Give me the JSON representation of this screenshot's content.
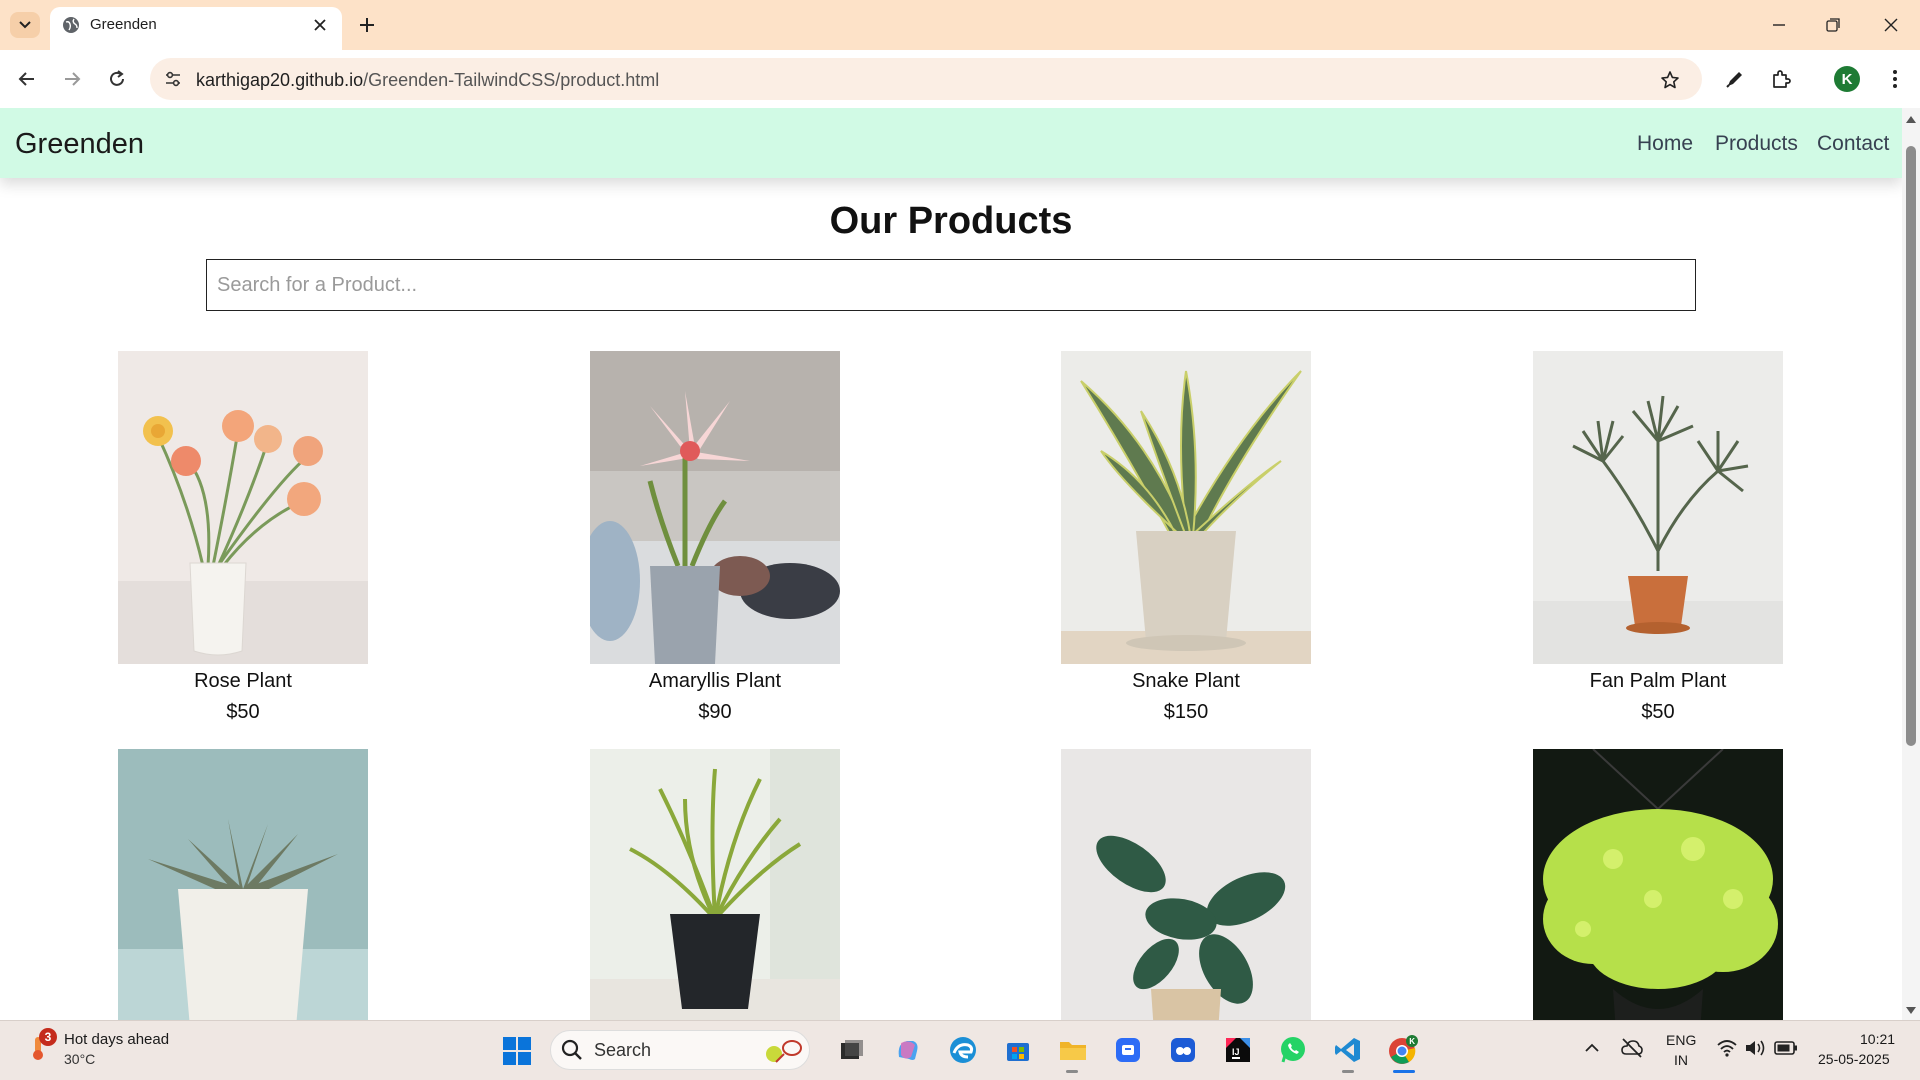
{
  "browser": {
    "tab_title": "Greenden",
    "url_host": "karthigap20.github.io",
    "url_path": "/Greenden-TailwindCSS/product.html",
    "profile_initial": "K"
  },
  "site": {
    "brand": "Greenden",
    "nav": [
      "Home",
      "Products",
      "Contact"
    ],
    "page_title": "Our Products",
    "search_placeholder": "Search for a Product...",
    "header_bg": "#d1fae5"
  },
  "products": [
    {
      "name": "Rose Plant",
      "price": "$50",
      "image": "ranunculus-bouquet-in-white-pot"
    },
    {
      "name": "Amaryllis Plant",
      "price": "$90",
      "image": "pink-amaryllis-in-grey-pot"
    },
    {
      "name": "Snake Plant",
      "price": "$150",
      "image": "snake-plant-in-beige-pot"
    },
    {
      "name": "Fan Palm Plant",
      "price": "$50",
      "image": "fan-palm-in-terracotta-pot"
    },
    {
      "name": "",
      "price": "",
      "image": "haworthia-succulent-in-white-pot"
    },
    {
      "name": "",
      "price": "",
      "image": "grass-plant-in-black-pot"
    },
    {
      "name": "",
      "price": "",
      "image": "rubber-plant-in-beige-pot"
    },
    {
      "name": "",
      "price": "",
      "image": "hanging-sedum-basket"
    }
  ],
  "taskbar": {
    "weather_title": "Hot days ahead",
    "weather_temp": "30°C",
    "weather_badge": "3",
    "search_label": "Search",
    "lang_line1": "ENG",
    "lang_line2": "IN",
    "time": "10:21",
    "date": "25-05-2025"
  }
}
